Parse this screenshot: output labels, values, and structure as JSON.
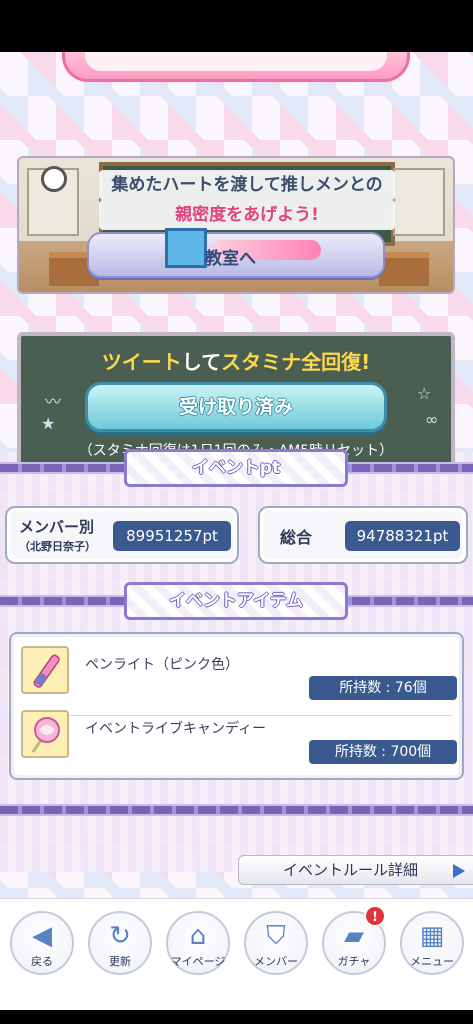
{
  "classroom": {
    "caption_line1": "集めたハートを渡して推しメンとの",
    "caption_line2": "親密度をあげよう!",
    "button_label": "教室へ"
  },
  "tweet": {
    "title_part1": "ツイート",
    "title_part2": "して",
    "title_part3": "スタミナ全回復!",
    "button_label": "受け取り済み",
    "note": "（スタミナ回復は1日1回のみ・AM5時リセット）"
  },
  "event_pt": {
    "section_title": "イベントpt",
    "member_label": "メンバー別",
    "member_name": "（北野日奈子）",
    "member_value": "89951257pt",
    "total_label": "総合",
    "total_value": "94788321pt"
  },
  "event_items": {
    "section_title": "イベントアイテム",
    "items": [
      {
        "name": "ペンライト（ピンク色）",
        "count": "所持数 : 76個",
        "icon": "penlight-icon"
      },
      {
        "name": "イベントライブキャンディー",
        "count": "所持数 : 700個",
        "icon": "candy-icon"
      }
    ]
  },
  "rules_button": {
    "label": "イベントルール詳細"
  },
  "nav": {
    "items": [
      {
        "label": "戻る",
        "icon": "back-arrow-icon"
      },
      {
        "label": "更新",
        "icon": "refresh-icon"
      },
      {
        "label": "マイページ",
        "icon": "home-icon"
      },
      {
        "label": "メンバー",
        "icon": "member-icon"
      },
      {
        "label": "ガチャ",
        "icon": "gacha-card-icon",
        "badge": "!"
      },
      {
        "label": "メニュー",
        "icon": "menu-grid-icon"
      }
    ]
  },
  "colors": {
    "accent_navy": "#3a5a8f",
    "pink": "#e0457e",
    "purple_band": "#7a64b8"
  }
}
